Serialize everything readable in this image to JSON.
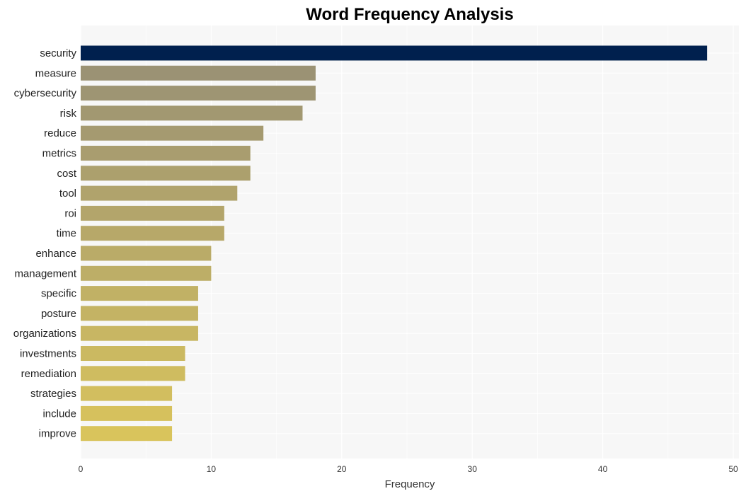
{
  "chart_data": {
    "type": "bar",
    "orientation": "horizontal",
    "title": "Word Frequency Analysis",
    "xlabel": "Frequency",
    "ylabel": "",
    "xlim": [
      0,
      50
    ],
    "xticks": [
      0,
      10,
      20,
      30,
      40,
      50
    ],
    "grid": true,
    "categories": [
      "security",
      "measure",
      "cybersecurity",
      "risk",
      "reduce",
      "metrics",
      "cost",
      "tool",
      "roi",
      "time",
      "enhance",
      "management",
      "specific",
      "posture",
      "organizations",
      "investments",
      "remediation",
      "strategies",
      "include",
      "improve"
    ],
    "values": [
      48,
      18,
      18,
      17,
      14,
      13,
      13,
      12,
      11,
      11,
      10,
      10,
      9,
      9,
      9,
      8,
      8,
      7,
      7,
      7
    ],
    "colors": {
      "highlight": "#00204e",
      "gradient_start": "#9b9274",
      "gradient_end": "#d9c45c",
      "plot_background": "#f7f7f7",
      "gridline": "#ffffff"
    }
  }
}
